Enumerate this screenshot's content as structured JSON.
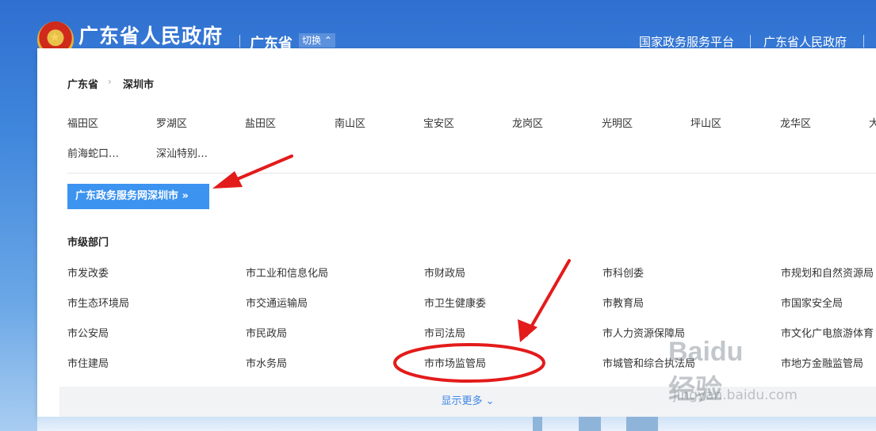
{
  "header": {
    "site_title": "广东省人民政府",
    "province": "广东省",
    "switch_label": "切换",
    "links": [
      "国家政务服务平台",
      "广东省人民政府"
    ]
  },
  "panel": {
    "breadcrumb": [
      "广东省",
      "深圳市"
    ],
    "districts": [
      "福田区",
      "罗湖区",
      "盐田区",
      "南山区",
      "宝安区",
      "龙岗区",
      "光明区",
      "坪山区",
      "龙华区",
      "大",
      "前海蛇口…",
      "深汕特别…"
    ],
    "portal_button": "广东政务服务网深圳市 »",
    "section_title": "市级部门",
    "departments": [
      [
        "市发改委",
        "市工业和信息化局",
        "市财政局",
        "市科创委",
        "市规划和自然资源局"
      ],
      [
        "市生态环境局",
        "市交通运输局",
        "市卫生健康委",
        "市教育局",
        "市国家安全局"
      ],
      [
        "市公安局",
        "市民政局",
        "市司法局",
        "市人力资源保障局",
        "市文化广电旅游体育"
      ],
      [
        "市住建局",
        "市水务局",
        "市市场监管局",
        "市城管和综合执法局",
        "市地方金融监管局"
      ]
    ],
    "more_label": "显示更多"
  },
  "watermark": {
    "logo": "Baidu经验",
    "sub": "jingyan.baidu.com"
  },
  "colors": {
    "header_blue": "#2f6fd0",
    "button_blue": "#3c93f0",
    "annotation_red": "#e31b1b"
  }
}
